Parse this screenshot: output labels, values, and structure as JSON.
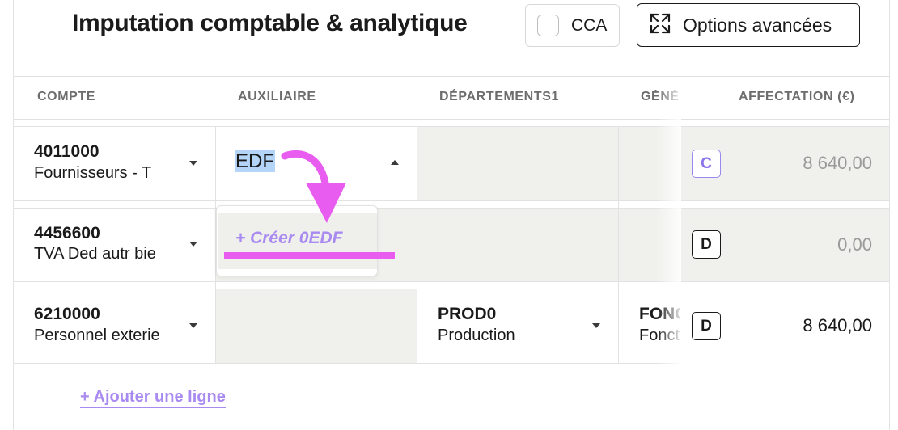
{
  "header": {
    "title": "Imputation comptable & analytique",
    "cca_label": "CCA",
    "options_label": "Options avancées"
  },
  "columns": [
    "COMPTE",
    "AUXILIAIRE",
    "DÉPARTEMENTS1",
    "GÉNÉ",
    "AFFECTATION (€)"
  ],
  "rows": [
    {
      "code": "4011000",
      "label": "Fournisseurs - T",
      "auxiliaire": "EDF",
      "dept_code": "",
      "dept_label": "",
      "gen_code": "",
      "gen_label": "",
      "badge": "C",
      "amount": "8 640,00"
    },
    {
      "code": "4456600",
      "label": "TVA Ded autr bie",
      "auxiliaire": "",
      "dept_code": "",
      "dept_label": "",
      "gen_code": "",
      "gen_label": "",
      "badge": "D",
      "amount": "0,00"
    },
    {
      "code": "6210000",
      "label": "Personnel exterie",
      "auxiliaire": "",
      "dept_code": "PROD0",
      "dept_label": "Production",
      "gen_code": "FONC",
      "gen_label": "Fonct",
      "badge": "D",
      "amount": "8 640,00"
    }
  ],
  "dropdown": {
    "create_option": "+ Créer 0EDF"
  },
  "footer": {
    "add_line": "+ Ajouter une ligne"
  },
  "colors": {
    "accent": "#a98af0",
    "annotation": "#e85cf0",
    "selection": "#b4d4f8",
    "muted_cell": "#f0f0ec"
  }
}
